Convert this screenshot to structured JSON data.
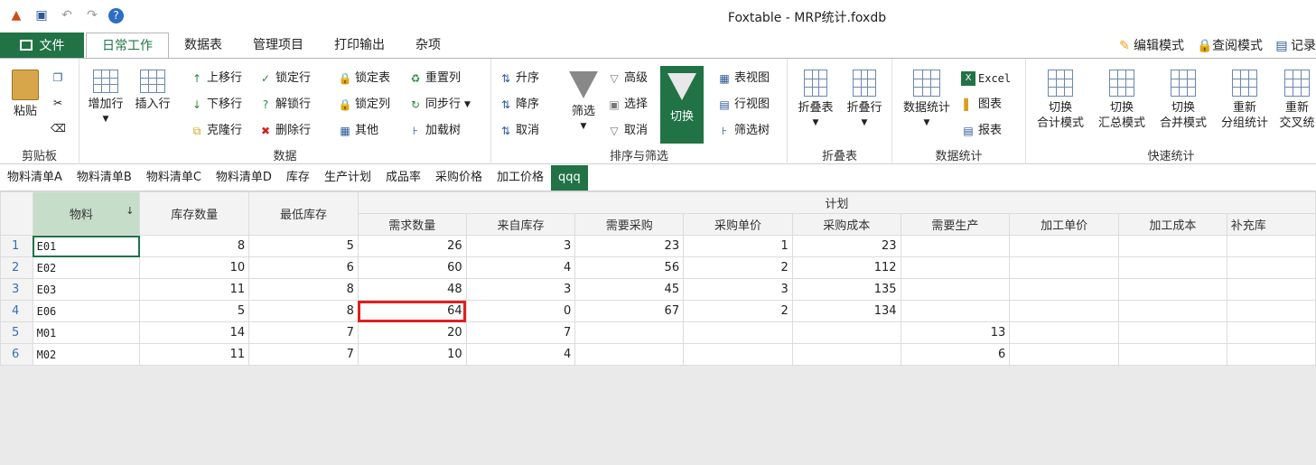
{
  "window": {
    "title": "Foxtable - MRP统计.foxdb"
  },
  "tabs": {
    "file": "文件",
    "items": [
      "日常工作",
      "数据表",
      "管理项目",
      "打印输出",
      "杂项"
    ],
    "right": [
      "编辑模式",
      "查阅模式",
      "记录"
    ]
  },
  "ribbon": {
    "clipboard": {
      "label": "剪贴板",
      "paste": "粘贴"
    },
    "data": {
      "label": "数据",
      "add_row": "增加行",
      "insert_row": "插入行",
      "move_up": "上移行",
      "move_down": "下移行",
      "clone_row": "克隆行",
      "lock_row": "锁定行",
      "unlock_row": "解锁行",
      "delete_row": "删除行",
      "lock_table": "锁定表",
      "lock_col": "锁定列",
      "other": "其他",
      "reset_col": "重置列",
      "sync_row": "同步行",
      "load_tree": "加载树"
    },
    "sort_filter": {
      "label": "排序与筛选",
      "asc": "升序",
      "desc": "降序",
      "cancel": "取消",
      "filter": "筛选",
      "advanced": "高级",
      "select": "选择",
      "cancel2": "取消",
      "toggle": "切换",
      "table_view": "表视图",
      "row_view": "行视图",
      "filter_tree": "筛选树"
    },
    "fold": {
      "label": "折叠表",
      "fold_table": "折叠表",
      "fold_row": "折叠行"
    },
    "stats": {
      "label": "数据统计",
      "data_stats": "数据统计",
      "excel": "Excel",
      "chart": "图表",
      "report": "报表"
    },
    "quick": {
      "label": "快速统计",
      "b1a": "切换",
      "b1b": "合计模式",
      "b2a": "切换",
      "b2b": "汇总模式",
      "b3a": "切换",
      "b3b": "合并模式",
      "b4a": "重新",
      "b4b": "分组统计",
      "b5a": "重新",
      "b5b": "交叉统"
    }
  },
  "sheets": [
    "物料清单A",
    "物料清单B",
    "物料清单C",
    "物料清单D",
    "库存",
    "生产计划",
    "成品率",
    "采购价格",
    "加工价格",
    "qqq"
  ],
  "grid": {
    "group_header": "计划",
    "fixed_cols": [
      "物料",
      "库存数量",
      "最低库存"
    ],
    "plan_cols": [
      "需求数量",
      "来自库存",
      "需要采购",
      "采购单价",
      "采购成本",
      "需要生产",
      "加工单价",
      "加工成本",
      "补充库"
    ],
    "rows": [
      {
        "n": "1",
        "cells": [
          "E01",
          "8",
          "5",
          "26",
          "3",
          "23",
          "1",
          "23",
          "",
          "",
          "",
          ""
        ]
      },
      {
        "n": "2",
        "cells": [
          "E02",
          "10",
          "6",
          "60",
          "4",
          "56",
          "2",
          "112",
          "",
          "",
          "",
          ""
        ]
      },
      {
        "n": "3",
        "cells": [
          "E03",
          "11",
          "8",
          "48",
          "3",
          "45",
          "3",
          "135",
          "",
          "",
          "",
          ""
        ]
      },
      {
        "n": "4",
        "cells": [
          "E06",
          "5",
          "8",
          "64",
          "0",
          "67",
          "2",
          "134",
          "",
          "",
          "",
          ""
        ]
      },
      {
        "n": "5",
        "cells": [
          "M01",
          "14",
          "7",
          "20",
          "7",
          "",
          "",
          "",
          "13",
          "",
          "",
          ""
        ]
      },
      {
        "n": "6",
        "cells": [
          "M02",
          "11",
          "7",
          "10",
          "4",
          "",
          "",
          "",
          "6",
          "",
          "",
          ""
        ]
      }
    ]
  },
  "colors": {
    "accent": "#217346",
    "highlight": "#e02020"
  }
}
